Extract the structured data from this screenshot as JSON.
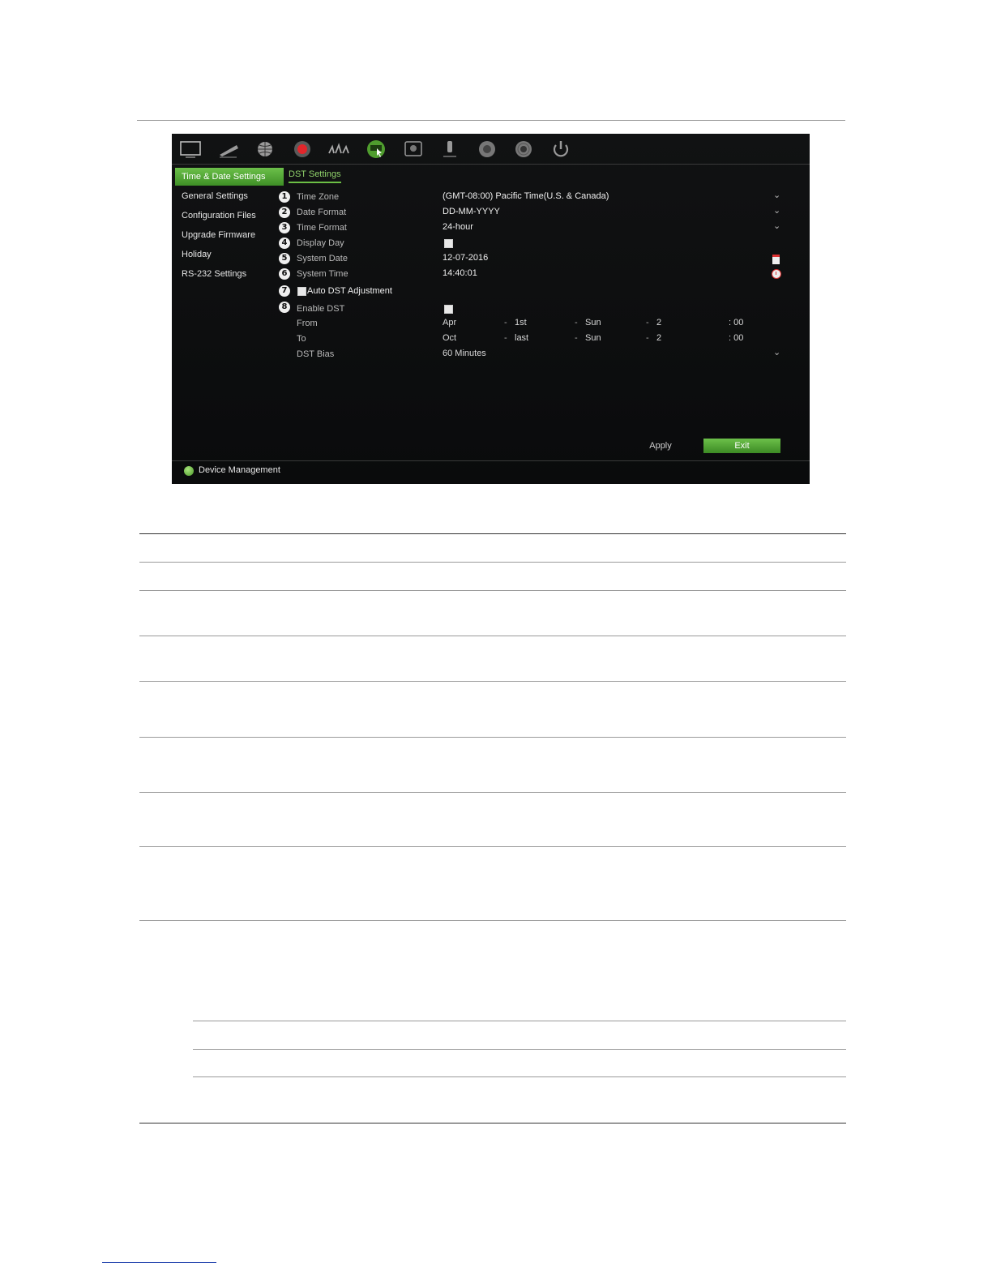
{
  "sidebar": {
    "items": [
      {
        "label": "Time & Date Settings",
        "active": true
      },
      {
        "label": "General Settings"
      },
      {
        "label": "Configuration Files"
      },
      {
        "label": "Upgrade Firmware"
      },
      {
        "label": "Holiday"
      },
      {
        "label": "RS-232 Settings"
      }
    ]
  },
  "tabs": {
    "dst": "DST Settings"
  },
  "form": {
    "time_zone": {
      "num": "1",
      "label": "Time Zone",
      "value": "(GMT-08:00) Pacific Time(U.S. & Canada)"
    },
    "date_format": {
      "num": "2",
      "label": "Date Format",
      "value": "DD-MM-YYYY"
    },
    "time_format": {
      "num": "3",
      "label": "Time Format",
      "value": "24-hour"
    },
    "display_day": {
      "num": "4",
      "label": "Display Day"
    },
    "system_date": {
      "num": "5",
      "label": "System Date",
      "value": "12-07-2016"
    },
    "system_time": {
      "num": "6",
      "label": "System Time",
      "value": "14:40:01"
    },
    "auto_dst": {
      "num": "7",
      "label": "Auto DST Adjustment"
    },
    "enable_dst": {
      "num": "8",
      "label": "Enable DST"
    },
    "from": {
      "label": "From",
      "month": "Apr",
      "week": "1st",
      "day": "Sun",
      "hour": "2",
      "minute": ": 00"
    },
    "to": {
      "label": "To",
      "month": "Oct",
      "week": "last",
      "day": "Sun",
      "hour": "2",
      "minute": ": 00"
    },
    "dst_bias": {
      "label": "DST Bias",
      "value": "60 Minutes"
    },
    "dropdown_glyph": "⌄",
    "separator": "-"
  },
  "buttons": {
    "apply": "Apply",
    "exit": "Exit"
  },
  "status": {
    "text": "Device Management"
  },
  "colors": {
    "accent": "#5fb33c",
    "panel": "#0e0f10"
  }
}
